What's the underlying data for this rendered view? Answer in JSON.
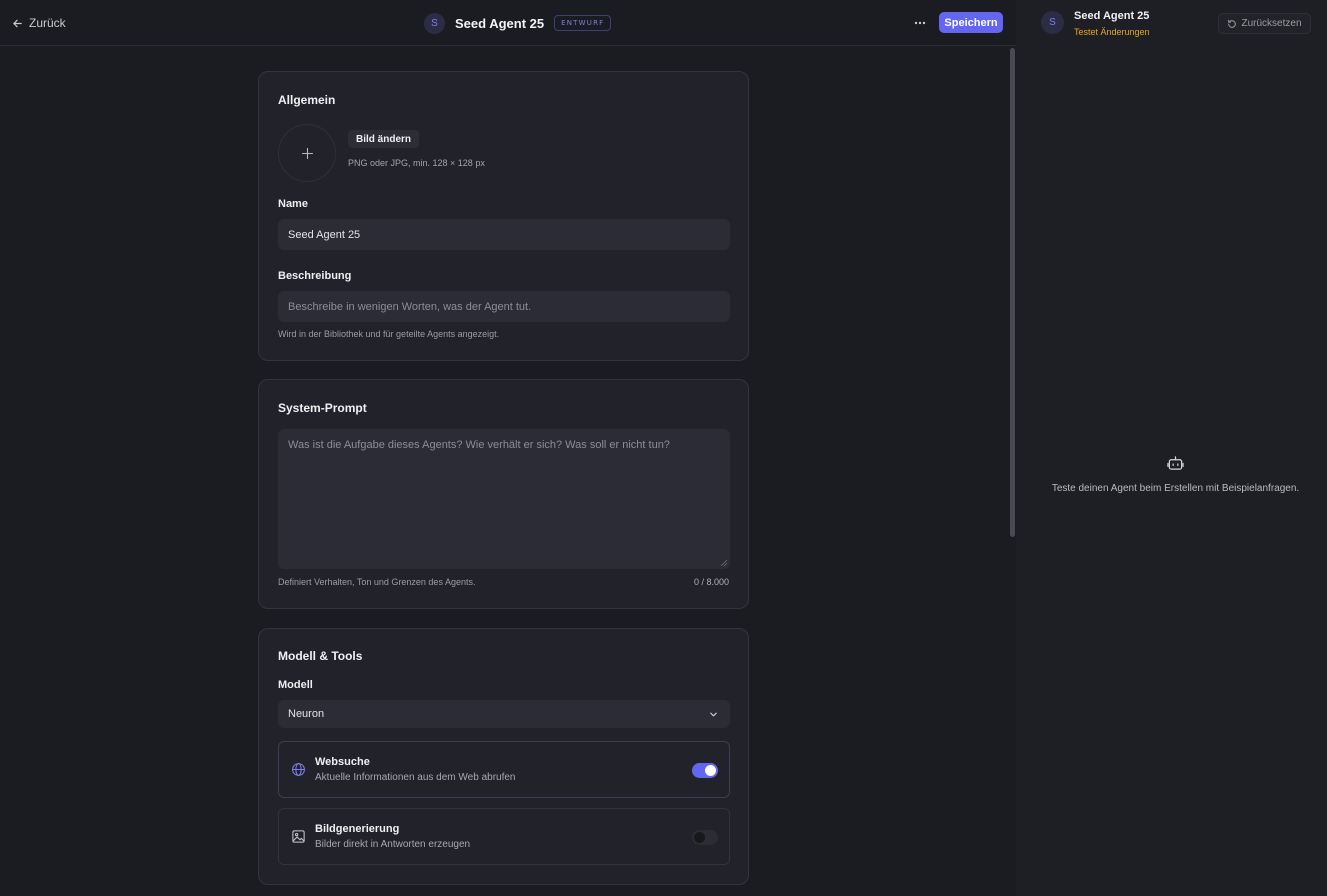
{
  "header": {
    "back_label": "Zurück",
    "avatar_letter": "S",
    "agent_name": "Seed Agent 25",
    "status_badge": "ENTWURF",
    "save_label": "Speichern",
    "more_icon": "more-horizontal-icon"
  },
  "general": {
    "title": "Allgemein",
    "image_button": "Bild ändern",
    "image_hint": "PNG oder JPG, min. 128 × 128 px",
    "name_label": "Name",
    "name_value": "Seed Agent 25",
    "description_label": "Beschreibung",
    "description_placeholder": "Beschreibe in wenigen Worten, was der Agent tut.",
    "description_hint": "Wird in der Bibliothek und für geteilte Agents angezeigt."
  },
  "system_prompt": {
    "title": "System-Prompt",
    "placeholder": "Was ist die Aufgabe dieses Agents? Wie verhält er sich? Was soll er nicht tun?",
    "hint": "Definiert Verhalten, Ton und Grenzen des Agents.",
    "char_count": "0 / 8.000"
  },
  "model_tools": {
    "title": "Modell & Tools",
    "model_label": "Modell",
    "model_value": "Neuron",
    "tools": [
      {
        "name": "Websuche",
        "description": "Aktuelle Informationen aus dem Web abrufen",
        "icon": "globe-icon",
        "enabled": true
      },
      {
        "name": "Bildgenerierung",
        "description": "Bilder direkt in Antworten erzeugen",
        "icon": "image-icon",
        "enabled": false
      }
    ]
  },
  "preview": {
    "avatar_letter": "S",
    "agent_name": "Seed Agent 25",
    "status": "Testet Änderungen",
    "reset_label": "Zurücksetzen",
    "empty_text": "Teste deinen Agent beim Erstellen mit Beispielanfragen."
  },
  "colors": {
    "accent": "#6366f1",
    "status_warning": "#e6a524",
    "background": "#1b1c21",
    "card": "#22232a"
  }
}
